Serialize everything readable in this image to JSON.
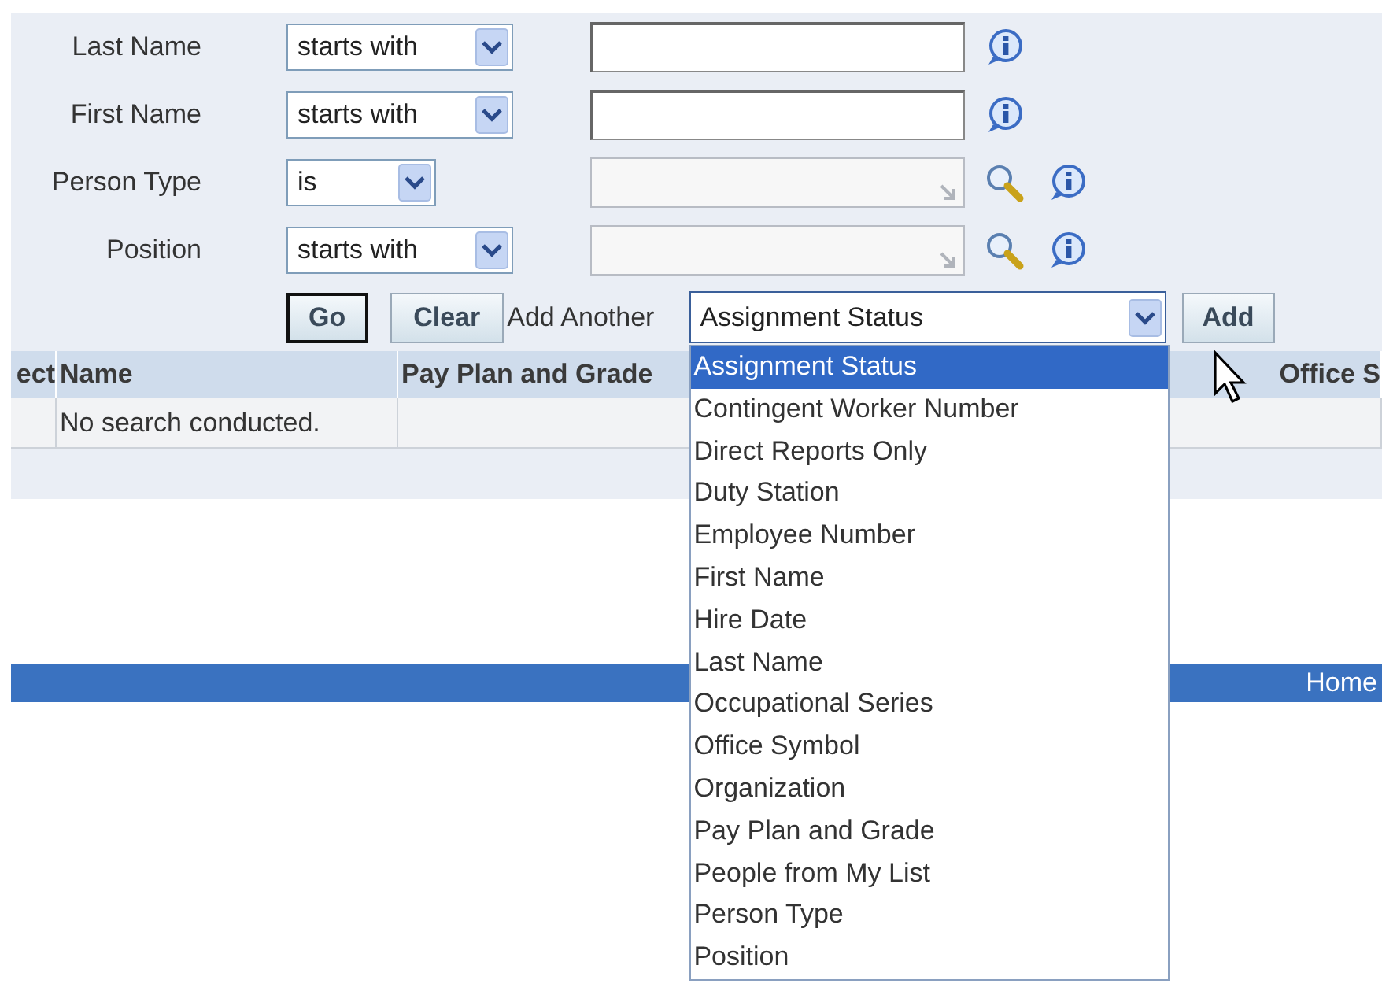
{
  "search": {
    "rows": [
      {
        "label": "Last Name",
        "operator": "starts with",
        "kind": "text",
        "lookup": false
      },
      {
        "label": "First Name",
        "operator": "starts with",
        "kind": "text",
        "lookup": false
      },
      {
        "label": "Person Type",
        "operator": "is",
        "kind": "list",
        "lookup": true
      },
      {
        "label": "Position",
        "operator": "starts with",
        "kind": "list",
        "lookup": true
      }
    ],
    "buttons": [
      {
        "label": "Go",
        "focused": true
      },
      {
        "label": "Clear",
        "focused": false
      }
    ],
    "add_another": {
      "label": "Add Another",
      "value": "Assignment Status",
      "expanded": true,
      "options": [
        {
          "label": "Assignment Status",
          "selected": true
        },
        {
          "label": "Contingent Worker Number",
          "selected": false
        },
        {
          "label": "Direct Reports Only",
          "selected": false
        },
        {
          "label": "Duty Station",
          "selected": false
        },
        {
          "label": "Employee Number",
          "selected": false
        },
        {
          "label": "First Name",
          "selected": false
        },
        {
          "label": "Hire Date",
          "selected": false
        },
        {
          "label": "Last Name",
          "selected": false
        },
        {
          "label": "Occupational Series",
          "selected": false
        },
        {
          "label": "Office Symbol",
          "selected": false
        },
        {
          "label": "Organization",
          "selected": false
        },
        {
          "label": "Pay Plan and Grade",
          "selected": false
        },
        {
          "label": "People from My List",
          "selected": false
        },
        {
          "label": "Person Type",
          "selected": false
        },
        {
          "label": "Position",
          "selected": false
        }
      ]
    },
    "add_button": "Add"
  },
  "table": {
    "columns": [
      "ect",
      "Name",
      "Pay Plan and Grade",
      "Office S"
    ],
    "rows": [
      [
        "",
        "No search conducted.",
        "",
        ""
      ]
    ]
  },
  "footer": {
    "link": "Home"
  }
}
